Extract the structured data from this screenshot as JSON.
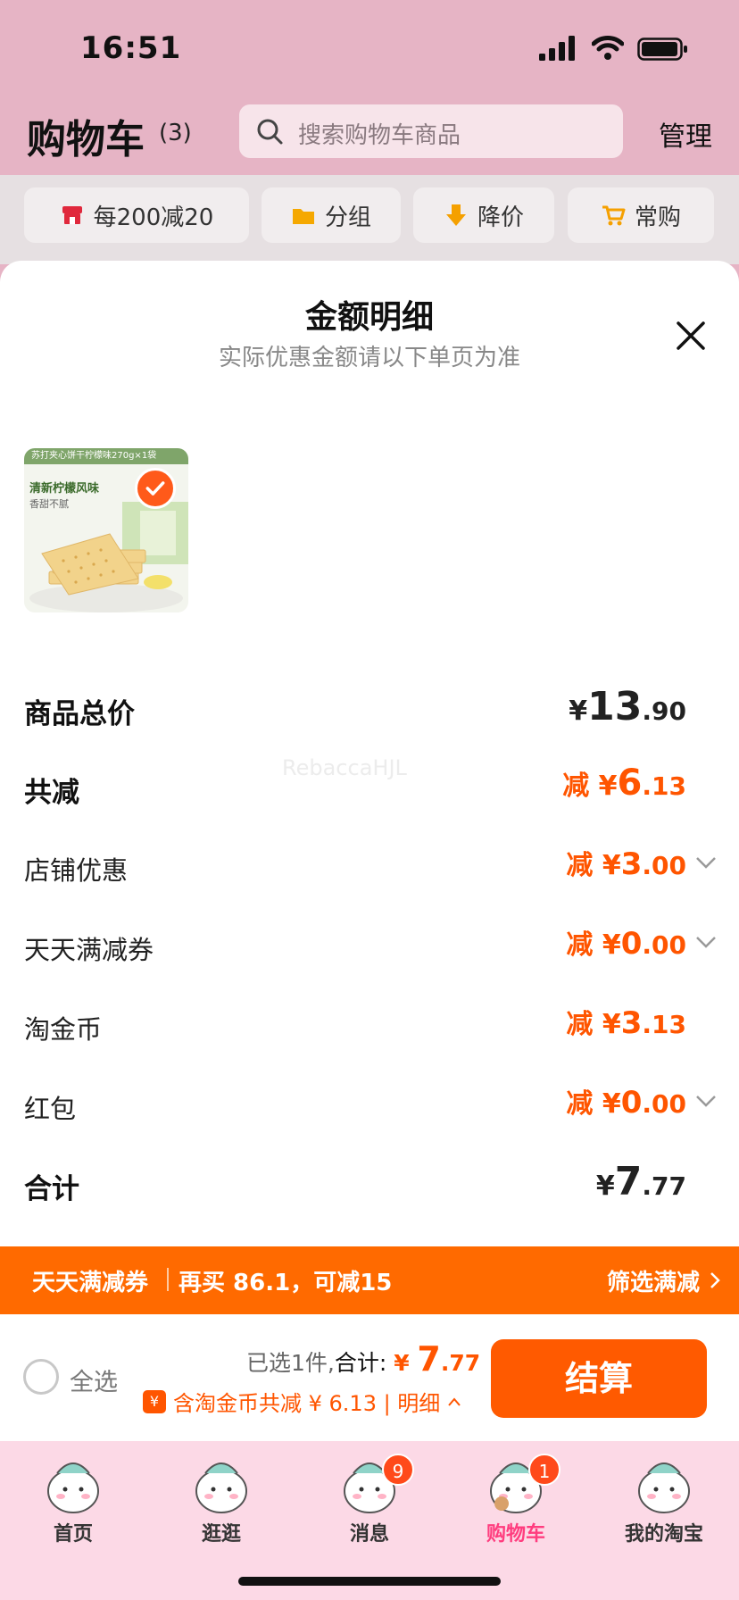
{
  "status": {
    "time": "16:51"
  },
  "header": {
    "title": "购物车",
    "count": "(3)",
    "search_placeholder": "搜索购物车商品",
    "manage": "管理"
  },
  "filters": [
    {
      "label": "每200减20",
      "icon": "store-icon"
    },
    {
      "label": "分组",
      "icon": "folder-icon"
    },
    {
      "label": "降价",
      "icon": "price-down-icon"
    },
    {
      "label": "常购",
      "icon": "cart-icon"
    }
  ],
  "sheet": {
    "title": "金额明细",
    "subtitle": "实际优惠金额请以下单页为准",
    "product": {
      "banner": "苏打夹心饼干柠檬味270g×1袋",
      "name": "清新柠檬风味",
      "tagline": "香甜不腻"
    },
    "rows": {
      "total": {
        "label": "商品总价",
        "currency": "¥",
        "int": "13",
        "dec": ".90"
      },
      "discount": {
        "label": "共减",
        "prefix": "减 ¥",
        "int": "6",
        "dec": ".13"
      },
      "shop": {
        "label": "店铺优惠",
        "prefix": "减 ¥",
        "int": "3",
        "dec": ".00"
      },
      "coupon": {
        "label": "天天满减券",
        "prefix": "减 ¥",
        "int": "0",
        "dec": ".00"
      },
      "coins": {
        "label": "淘金币",
        "prefix": "减 ¥",
        "int": "3",
        "dec": ".13"
      },
      "redpacket": {
        "label": "红包",
        "prefix": "减 ¥",
        "int": "0",
        "dec": ".00"
      },
      "sum": {
        "label": "合计",
        "currency": "¥",
        "int": "7",
        "dec": ".77"
      }
    },
    "watermark": "RebaccaHJL"
  },
  "promo": {
    "left": "天天满减券",
    "middle": "再买 86.1，可减15",
    "right": "筛选满减"
  },
  "checkout": {
    "select_all": "全选",
    "selected": "已选1件,",
    "total_label": "合计:",
    "currency": "¥",
    "int": "7",
    "dec": ".77",
    "rebate_tag": "¥",
    "rebate": "含淘金币共减 ¥ 6.13 | 明细",
    "pay": "结算"
  },
  "tabs": [
    {
      "label": "首页",
      "badge": ""
    },
    {
      "label": "逛逛",
      "badge": ""
    },
    {
      "label": "消息",
      "badge": "9"
    },
    {
      "label": "购物车",
      "badge": "1"
    },
    {
      "label": "我的淘宝",
      "badge": ""
    }
  ],
  "colors": {
    "accent": "#ff5500",
    "promo_bg": "#ff6a00",
    "tab_active": "#ff3d7f",
    "tabbar_bg": "#fcd9e6"
  }
}
